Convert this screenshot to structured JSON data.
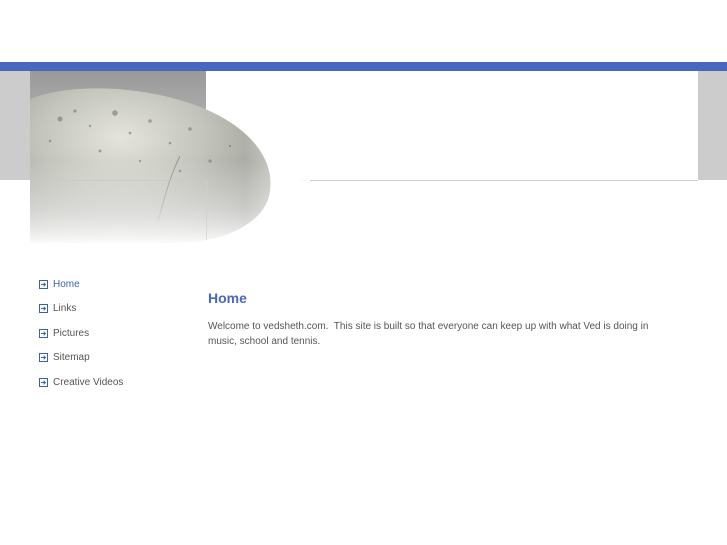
{
  "nav": {
    "items": [
      {
        "label": "Home",
        "active": true,
        "icon": "arrow-box-icon"
      },
      {
        "label": "Links",
        "active": false,
        "icon": "arrow-box-icon"
      },
      {
        "label": "Pictures",
        "active": false,
        "icon": "arrow-box-icon"
      },
      {
        "label": "Sitemap",
        "active": false,
        "icon": "arrow-box-icon"
      },
      {
        "label": "Creative Videos",
        "active": false,
        "icon": "arrow-box-icon"
      }
    ]
  },
  "main": {
    "title": "Home",
    "welcome_text": "Welcome to vedsheth.com.  This site is built so that everyone can keep up with what Ved is doing in music, school and tennis."
  },
  "colors": {
    "accent": "#4a67c0",
    "link_active": "#3d5fb3",
    "text": "#555555",
    "side_panel": "#cccccc"
  }
}
